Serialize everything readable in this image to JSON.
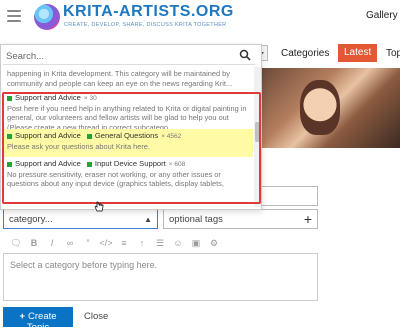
{
  "header": {
    "logo_title": "KRITA-ARTISTS.ORG",
    "logo_tagline": "CREATE, DEVELOP, SHARE, DISCUSS KRITA TOGETHER",
    "gallery_label": "Gallery"
  },
  "nav": {
    "arrow": "▶",
    "tabs": [
      {
        "label": "Categories"
      },
      {
        "label": "Latest",
        "active": true
      },
      {
        "label": "Top"
      }
    ]
  },
  "search": {
    "placeholder": "Search...",
    "partial_description": "happening in Krita development. This category will be maintained by community and people can keep an eye on the news regarding Krit...",
    "results": [
      {
        "category": "Support and Advice",
        "subcategory": "",
        "count": "× 30",
        "description": "Post here if you need help in anything related to Krita or digital painting in general, our volunteers and fellow artists will be glad to help you out (Please create a new thread in correct subcatego...",
        "color": "#27a13a",
        "highlighted": false
      },
      {
        "category": "Support and Advice",
        "subcategory": "General Questions",
        "count": "× 4562",
        "description": "Please ask your questions about Krita here.",
        "color": "#27a13a",
        "highlighted": true
      },
      {
        "category": "Support and Advice",
        "subcategory": "Input Device Support",
        "count": "× 608",
        "description": "No pressure sensitivity, eraser not working, or any other issues or questions about any input device (graphics tablets, display tablets,",
        "color": "#27a13a",
        "highlighted": false
      }
    ]
  },
  "composer": {
    "category_placeholder": "category...",
    "tags_placeholder": "optional tags",
    "editor_placeholder": "Select a category before typing here.",
    "create_label": "Create Topic",
    "close_label": "Close"
  },
  "colors": {
    "accent": "#e45735",
    "primary_button": "#0a73c4",
    "highlight": "#fffaa6",
    "category_green": "#27a13a",
    "annotation_red": "#e23a3a"
  }
}
